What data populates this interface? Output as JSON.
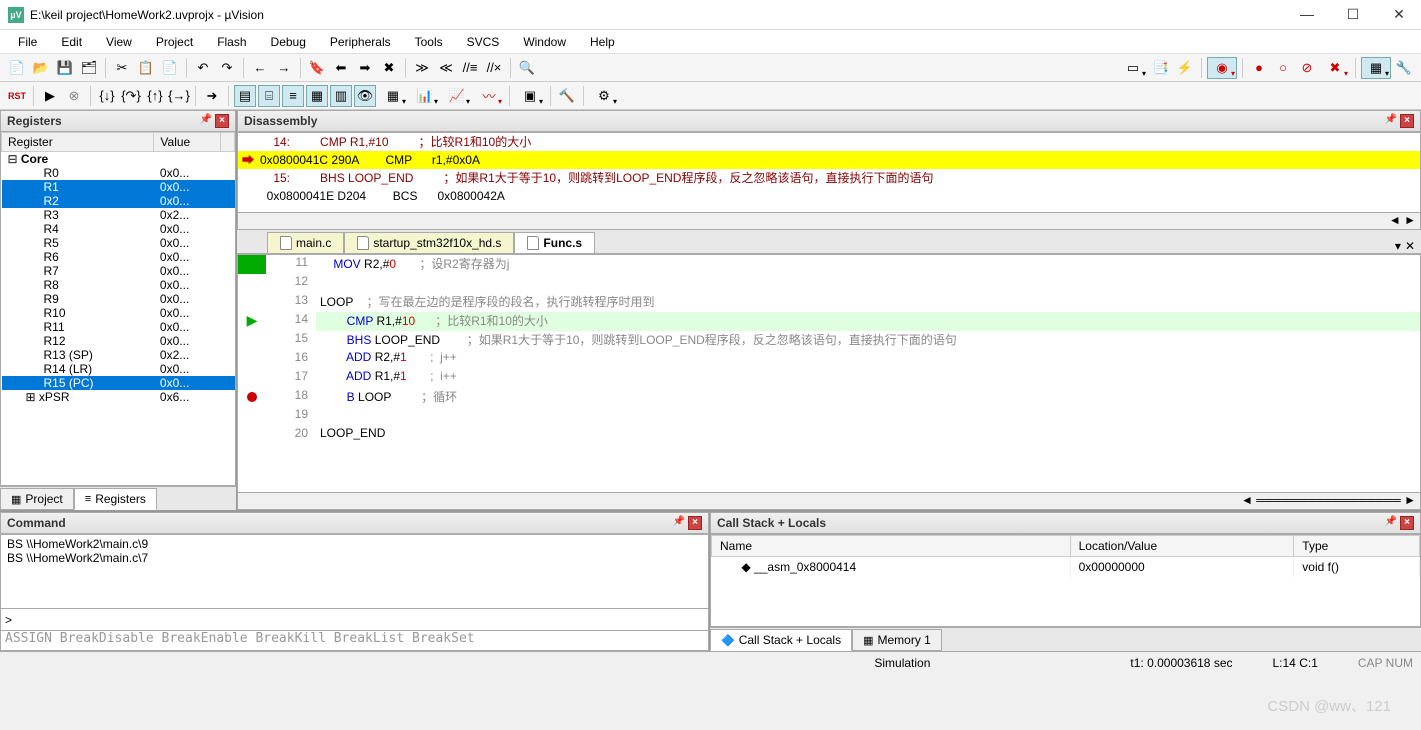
{
  "window": {
    "title": "E:\\keil project\\HomeWork2.uvprojx - µVision"
  },
  "menu": [
    "File",
    "Edit",
    "View",
    "Project",
    "Flash",
    "Debug",
    "Peripherals",
    "Tools",
    "SVCS",
    "Window",
    "Help"
  ],
  "panels": {
    "registers": {
      "title": "Registers",
      "col1": "Register",
      "col2": "Value"
    },
    "disassembly": {
      "title": "Disassembly"
    },
    "command": {
      "title": "Command"
    },
    "callstack": {
      "title": "Call Stack + Locals",
      "cols": [
        "Name",
        "Location/Value",
        "Type"
      ]
    }
  },
  "registers": {
    "core_label": "Core",
    "rows": [
      {
        "name": "R0",
        "val": "0x0...",
        "sel": false
      },
      {
        "name": "R1",
        "val": "0x0...",
        "sel": true
      },
      {
        "name": "R2",
        "val": "0x0...",
        "sel": true
      },
      {
        "name": "R3",
        "val": "0x2...",
        "sel": false
      },
      {
        "name": "R4",
        "val": "0x0...",
        "sel": false
      },
      {
        "name": "R5",
        "val": "0x0...",
        "sel": false
      },
      {
        "name": "R6",
        "val": "0x0...",
        "sel": false
      },
      {
        "name": "R7",
        "val": "0x0...",
        "sel": false
      },
      {
        "name": "R8",
        "val": "0x0...",
        "sel": false
      },
      {
        "name": "R9",
        "val": "0x0...",
        "sel": false
      },
      {
        "name": "R10",
        "val": "0x0...",
        "sel": false
      },
      {
        "name": "R11",
        "val": "0x0...",
        "sel": false
      },
      {
        "name": "R12",
        "val": "0x0...",
        "sel": false
      },
      {
        "name": "R13 (SP)",
        "val": "0x2...",
        "sel": false
      },
      {
        "name": "R14 (LR)",
        "val": "0x0...",
        "sel": false
      },
      {
        "name": "R15 (PC)",
        "val": "0x0...",
        "sel": true
      },
      {
        "name": "xPSR",
        "val": "0x6...",
        "sel": false
      }
    ]
  },
  "bottom_tabs": {
    "project": "Project",
    "registers": "Registers"
  },
  "disasm": {
    "l1": {
      "ln": "    14:",
      "code": "         CMP R1,#10",
      "cmt": "         ；比较R1和10的大小"
    },
    "l2": {
      "addr": "0x0800041C",
      "hex": "290A",
      "op": "CMP",
      "args": "r1,#0x0A"
    },
    "l3": {
      "ln": "    15:",
      "code": "         BHS LOOP_END",
      "cmt": "         ；如果R1大于等于10，则跳转到LOOP_END程序段，反之忽略该语句，直接执行下面的语句"
    },
    "l4": {
      "addr": "0x0800041E",
      "hex": "D204",
      "op": "BCS",
      "args": "0x0800042A"
    }
  },
  "file_tabs": [
    "main.c",
    "startup_stm32f10x_hd.s",
    "Func.s"
  ],
  "code": {
    "11": {
      "op": "MOV",
      "args": "R2,#0",
      "cmt": "；设R2寄存器为j"
    },
    "12": {
      "op": "",
      "args": "",
      "cmt": ""
    },
    "13": {
      "label": "LOOP",
      "cmt": "；写在最左边的是程序段的段名，执行跳转程序时用到"
    },
    "14": {
      "op": "CMP",
      "args": "R1,#10",
      "cmt": "；比较R1和10的大小"
    },
    "15": {
      "op": "BHS",
      "args": "LOOP_END",
      "cmt": "；如果R1大于等于10，则跳转到LOOP_END程序段，反之忽略该语句，直接执行下面的语句"
    },
    "16": {
      "op": "ADD",
      "args": "R2,#1",
      "cmt": ";  j++"
    },
    "17": {
      "op": "ADD",
      "args": "R1,#1",
      "cmt": ";  i++"
    },
    "18": {
      "op": "B",
      "args": "LOOP",
      "cmt": "；循环"
    },
    "19": {
      "op": "",
      "args": "",
      "cmt": ""
    },
    "20": {
      "label": "LOOP_END",
      "cmt": ""
    }
  },
  "command": {
    "lines": [
      "BS \\\\HomeWork2\\main.c\\9",
      "BS \\\\HomeWork2\\main.c\\7"
    ],
    "prompt": ">",
    "helper": "ASSIGN BreakDisable BreakEnable BreakKill BreakList BreakSet"
  },
  "callstack": {
    "row": {
      "name": "__asm_0x8000414",
      "loc": "0x00000000",
      "type": "void f()"
    }
  },
  "cs_tabs": [
    "Call Stack + Locals",
    "Memory 1"
  ],
  "status": {
    "sim": "Simulation",
    "time": "t1: 0.00003618 sec",
    "pos": "L:14 C:1",
    "caps": "CAP NUM"
  },
  "watermark": "CSDN @ww、121"
}
